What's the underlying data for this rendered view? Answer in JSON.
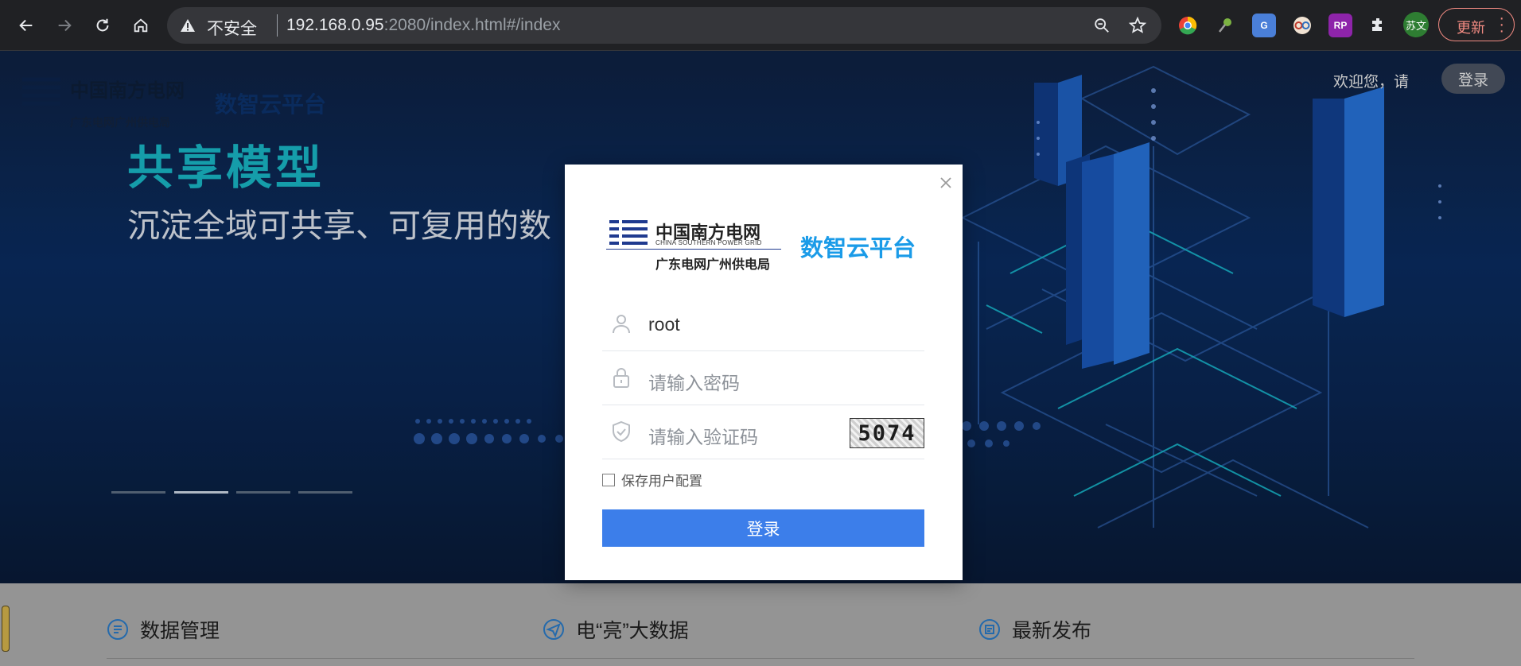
{
  "browser": {
    "security_label": "不安全",
    "url_host": "192.168.0.95",
    "url_rest": ":2080/index.html#/index",
    "profile_label": "苏文",
    "update_label": "更新"
  },
  "header": {
    "logo_text": "中国南方电网",
    "logo_sub": "广东电网广州供电局",
    "platform_name": "数智云平台",
    "welcome_text": "欢迎您，请",
    "login_label": "登录"
  },
  "banner": {
    "title": "共享模型",
    "subtitle": "沉淀全域可共享、可复用的数",
    "slide_count": 4,
    "active_slide": 2
  },
  "login_modal": {
    "logo_text": "中国南方电网",
    "logo_en": "CHINA SOUTHERN POWER GRID",
    "logo_sub": "广东电网广州供电局",
    "platform_name": "数智云平台",
    "username_value": "root",
    "password_placeholder": "请输入密码",
    "captcha_placeholder": "请输入验证码",
    "captcha_code": "5074",
    "remember_label": "保存用户配置",
    "remember_checked": false,
    "login_button": "登录"
  },
  "sections": [
    {
      "label": "数据管理",
      "icon": "data-management-icon"
    },
    {
      "label": "电“亮”大数据",
      "icon": "send-icon"
    },
    {
      "label": "最新发布",
      "icon": "release-icon"
    }
  ],
  "colors": {
    "accent_teal": "#19b3c2",
    "login_blue": "#3c7eea",
    "platform_blue": "#1a9be8",
    "update_red": "#f28b82"
  }
}
